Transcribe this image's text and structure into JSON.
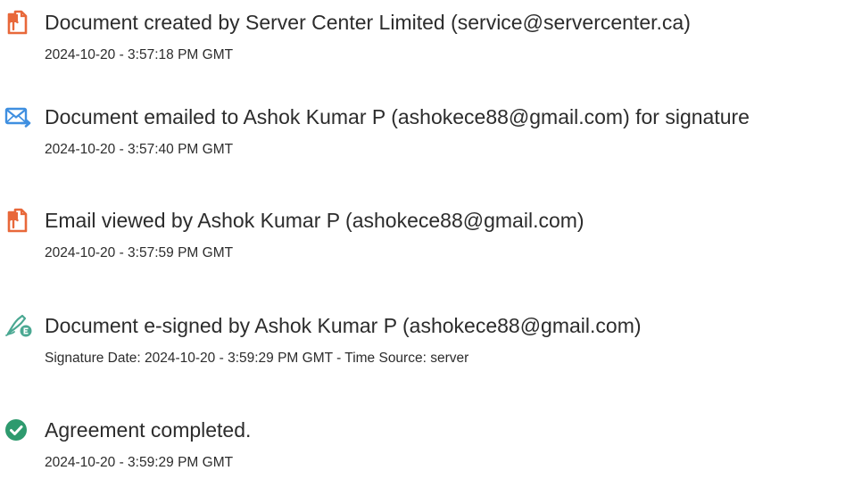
{
  "events": [
    {
      "icon": "document-created-icon",
      "title": "Document created by Server Center Limited (service@servercenter.ca)",
      "meta": "2024-10-20 - 3:57:18 PM GMT"
    },
    {
      "icon": "email-sent-icon",
      "title": "Document emailed to Ashok Kumar P (ashokece88@gmail.com) for signature",
      "meta": "2024-10-20 - 3:57:40 PM GMT"
    },
    {
      "icon": "email-viewed-icon",
      "title": "Email viewed by Ashok Kumar P (ashokece88@gmail.com)",
      "meta": "2024-10-20 - 3:57:59 PM GMT"
    },
    {
      "icon": "e-sign-icon",
      "title": "Document e-signed by Ashok Kumar P (ashokece88@gmail.com)",
      "meta": "Signature Date: 2024-10-20 - 3:59:29 PM GMT - Time Source: server"
    },
    {
      "icon": "check-circle-icon",
      "title": "Agreement completed.",
      "meta": "2024-10-20 - 3:59:29 PM GMT"
    }
  ],
  "colors": {
    "doc_icon": "#e8683a",
    "mail_icon": "#3f8fe0",
    "sign_icon": "#4aa892",
    "complete_icon": "#2e9a6e",
    "text": "#2c2c2c"
  }
}
